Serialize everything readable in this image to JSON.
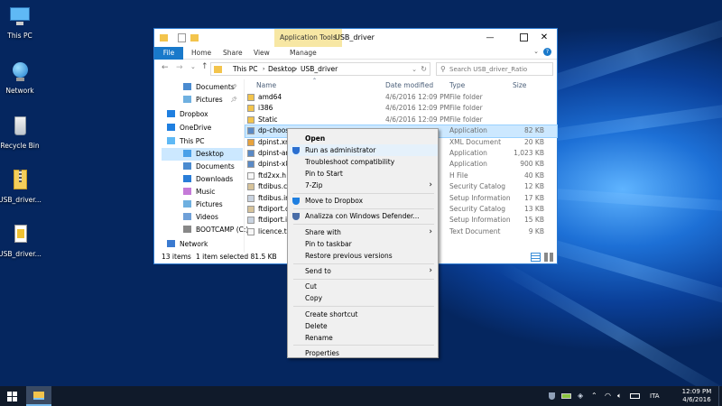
{
  "desktop": {
    "icons": [
      {
        "label": "This PC",
        "icon": "monitor-icon"
      },
      {
        "label": "Network",
        "icon": "network-globe-icon"
      },
      {
        "label": "Recycle Bin",
        "icon": "recycle-bin-icon"
      },
      {
        "label": "USB_driver...",
        "icon": "zip-folder-icon"
      },
      {
        "label": "USB_driver...",
        "icon": "document-icon"
      }
    ]
  },
  "explorer": {
    "title": "USB_driver",
    "ribbon_context_tab": "Application Tools",
    "ribbon_context_sub": "Manage",
    "ribbon_tabs": [
      "File",
      "Home",
      "Share",
      "View"
    ],
    "breadcrumb": [
      "This PC",
      "Desktop",
      "USB_driver"
    ],
    "search_placeholder": "Search USB_driver_Ratio",
    "columns": {
      "name": "Name",
      "date": "Date modified",
      "type": "Type",
      "size": "Size"
    },
    "nav": [
      {
        "label": "Documents",
        "pinned": true
      },
      {
        "label": "Pictures",
        "pinned": true
      },
      {
        "label": "Dropbox"
      },
      {
        "label": "OneDrive"
      },
      {
        "label": "This PC"
      },
      {
        "label": "Desktop",
        "selected": true
      },
      {
        "label": "Documents"
      },
      {
        "label": "Downloads"
      },
      {
        "label": "Music"
      },
      {
        "label": "Pictures"
      },
      {
        "label": "Videos"
      },
      {
        "label": "BOOTCAMP (C:)"
      },
      {
        "label": "Network"
      }
    ],
    "files": [
      {
        "name": "amd64",
        "date": "4/6/2016 12:09 PM",
        "type": "File folder",
        "size": "",
        "kind": "folder"
      },
      {
        "name": "i386",
        "date": "4/6/2016 12:09 PM",
        "type": "File folder",
        "size": "",
        "kind": "folder"
      },
      {
        "name": "Static",
        "date": "4/6/2016 12:09 PM",
        "type": "File folder",
        "size": "",
        "kind": "folder"
      },
      {
        "name": "dp-choose",
        "date": "",
        "type": "Application",
        "size": "82 KB",
        "kind": "app",
        "selected": true
      },
      {
        "name": "dpinst.xml",
        "date": "",
        "type": "XML Document",
        "size": "20 KB",
        "kind": "xml"
      },
      {
        "name": "dpinst-amd64",
        "date": "",
        "type": "Application",
        "size": "1,023 KB",
        "kind": "app"
      },
      {
        "name": "dpinst-x86",
        "date": "",
        "type": "Application",
        "size": "900 KB",
        "kind": "app"
      },
      {
        "name": "ftd2xx.h",
        "date": "",
        "type": "H File",
        "size": "40 KB",
        "kind": "file"
      },
      {
        "name": "ftdibus.cat",
        "date": "",
        "type": "Security Catalog",
        "size": "12 KB",
        "kind": "cat"
      },
      {
        "name": "ftdibus.inf",
        "date": "",
        "type": "Setup Information",
        "size": "17 KB",
        "kind": "inf"
      },
      {
        "name": "ftdiport.cat",
        "date": "",
        "type": "Security Catalog",
        "size": "13 KB",
        "kind": "cat"
      },
      {
        "name": "ftdiport.inf",
        "date": "",
        "type": "Setup Information",
        "size": "15 KB",
        "kind": "inf"
      },
      {
        "name": "licence.txt",
        "date": "",
        "type": "Text Document",
        "size": "9 KB",
        "kind": "file"
      }
    ],
    "status": {
      "count": "13 items",
      "selected": "1 item selected  81.5 KB"
    }
  },
  "context_menu": [
    {
      "label": "Open",
      "bold": true
    },
    {
      "label": "Run as administrator",
      "icon": "uac-shield-icon"
    },
    {
      "label": "Troubleshoot compatibility"
    },
    {
      "label": "Pin to Start"
    },
    {
      "label": "7-Zip",
      "submenu": true
    },
    {
      "sep": true
    },
    {
      "label": "Move to Dropbox",
      "icon": "dropbox-icon"
    },
    {
      "sep": true
    },
    {
      "label": "Analizza con Windows Defender...",
      "icon": "defender-icon"
    },
    {
      "sep": true
    },
    {
      "label": "Share with",
      "submenu": true
    },
    {
      "label": "Pin to taskbar"
    },
    {
      "label": "Restore previous versions"
    },
    {
      "sep": true
    },
    {
      "label": "Send to",
      "submenu": true
    },
    {
      "sep": true
    },
    {
      "label": "Cut"
    },
    {
      "label": "Copy"
    },
    {
      "sep": true
    },
    {
      "label": "Create shortcut"
    },
    {
      "label": "Delete"
    },
    {
      "label": "Rename"
    },
    {
      "sep": true
    },
    {
      "label": "Properties"
    }
  ],
  "taskbar": {
    "language": "ITA",
    "time": "12:09 PM",
    "date": "4/6/2016"
  },
  "colors": {
    "selection": "#cce8ff",
    "accent": "#1979ca",
    "taskbar": "#101a2a"
  }
}
